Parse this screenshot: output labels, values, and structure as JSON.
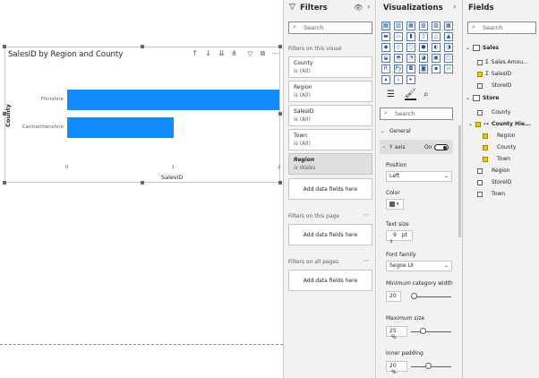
{
  "visual": {
    "title": "SalesID by Region and County",
    "y_axis_title": "County",
    "x_axis_title": "SalesID"
  },
  "chart_data": {
    "type": "bar",
    "orientation": "horizontal",
    "categories": [
      "Flintshire",
      "Carmarthenshire"
    ],
    "values": [
      2,
      1
    ],
    "xlim": [
      0,
      2
    ],
    "x_ticks": [
      "0",
      "1",
      "2"
    ],
    "xlabel": "SalesID",
    "ylabel": "County",
    "title": "SalesID by Region and County",
    "color": "#118dff"
  },
  "filters": {
    "title": "Filters",
    "search_placeholder": "Search",
    "on_visual_label": "Filters on this visual",
    "cards": [
      {
        "name": "County",
        "value": "is (All)"
      },
      {
        "name": "Region",
        "value": "is (All)"
      },
      {
        "name": "SalesID",
        "value": "is (All)"
      },
      {
        "name": "Town",
        "value": "is (All)"
      },
      {
        "name": "Region",
        "value": "is Wales"
      }
    ],
    "add_label": "Add data fields here",
    "on_page_label": "Filters on this page",
    "on_all_pages_label": "Filters on all pages"
  },
  "viz": {
    "title": "Visualizations",
    "icons": [
      "▤",
      "▥",
      "▦",
      "▧",
      "▨",
      "▩",
      "▬",
      "▭",
      "▮",
      "▯",
      "△",
      "▲",
      "◆",
      "◇",
      "○",
      "●",
      "◐",
      "◑",
      "◒",
      "◓",
      "◔",
      "◕",
      "▣",
      "▢",
      "R",
      "Py",
      "◘",
      "◙",
      "▪",
      "▫",
      "▴",
      "▵",
      "▸"
    ],
    "search_placeholder": "Search",
    "general_label": "General",
    "yaxis_label": "Y axis",
    "toggle_label": "On",
    "position_label": "Position",
    "position_value": "Left",
    "color_label": "Color",
    "textsize_label": "Text size",
    "textsize_value": "9",
    "textsize_unit": "pt",
    "font_family_label": "Font family",
    "font_family_value": "Segoe UI",
    "min_cat_width_label": "Minimum category width",
    "min_cat_width_value": "20",
    "max_size_label": "Maximum size",
    "max_size_value": "25",
    "max_size_unit": "%",
    "inner_padding_label": "Inner padding",
    "inner_padding_value": "20",
    "inner_padding_unit": "%"
  },
  "fields": {
    "title": "Fields",
    "search_placeholder": "Search",
    "sales_table": "Sales",
    "sales_items": [
      "Sales Amou...",
      "SalesID",
      "StoreID"
    ],
    "store_table": "Store",
    "store_items_top": [
      "County"
    ],
    "hierarchy": "County Hie...",
    "hierarchy_items": [
      "Region",
      "County",
      "Town"
    ],
    "store_items_bottom": [
      "Region",
      "StoreID",
      "Town"
    ],
    "sigma": "Σ"
  }
}
